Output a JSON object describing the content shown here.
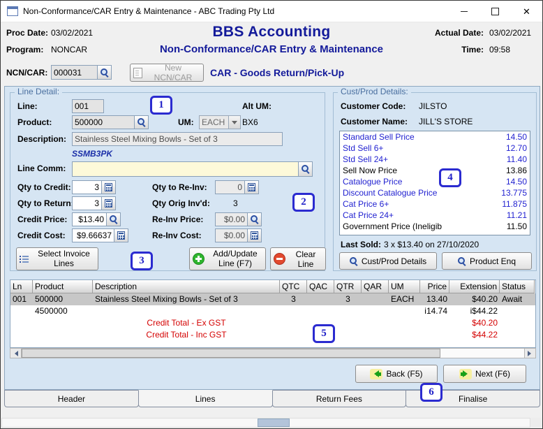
{
  "window": {
    "title": "Non-Conformance/CAR Entry & Maintenance - ABC Trading Pty Ltd"
  },
  "header": {
    "proc_date_label": "Proc Date:",
    "proc_date": "03/02/2021",
    "program_label": "Program:",
    "program": "NONCAR",
    "app_title": "BBS Accounting",
    "screen_title": "Non-Conformance/CAR Entry & Maintenance",
    "actual_date_label": "Actual Date:",
    "actual_date": "03/02/2021",
    "time_label": "Time:",
    "time": "09:58"
  },
  "ncn_bar": {
    "label": "NCN/CAR:",
    "value": "000031",
    "new_button": "New NCN/CAR",
    "car_type": "CAR - Goods Return/Pick-Up"
  },
  "line_detail": {
    "title": "Line Detail:",
    "line_label": "Line:",
    "line_value": "001",
    "product_label": "Product:",
    "product_value": "500000",
    "um_label": "UM:",
    "um_value": "EACH",
    "alt_um_label": "Alt UM:",
    "alt_um_value": "BX6",
    "description_label": "Description:",
    "description_value": "Stainless Steel Mixing Bowls - Set of 3",
    "product_code": "SSMB3PK",
    "line_comm_label": "Line Comm:",
    "line_comm_value": "",
    "qty_credit_label": "Qty to Credit:",
    "qty_credit": "3",
    "qty_reinv_label": "Qty to Re-Inv:",
    "qty_reinv": "0",
    "qty_return_label": "Qty to Return:",
    "qty_return": "3",
    "qty_orig_label": "Qty Orig Inv'd:",
    "qty_orig": "3",
    "credit_price_label": "Credit Price:",
    "credit_price": "$13.40",
    "reinv_price_label": "Re-Inv Price:",
    "reinv_price": "$0.00",
    "credit_cost_label": "Credit Cost:",
    "credit_cost": "$9.66637",
    "reinv_cost_label": "Re-Inv Cost:",
    "reinv_cost": "$0.00",
    "buttons": {
      "select_invoice": "Select Invoice Lines",
      "add_update": "Add/Update Line (F7)",
      "clear": "Clear Line"
    }
  },
  "cust_prod": {
    "title": "Cust/Prod Details:",
    "customer_code_label": "Customer Code:",
    "customer_code": "JILSTO",
    "customer_name_label": "Customer Name:",
    "customer_name": "JILL'S STORE",
    "prices": [
      {
        "label": "Standard Sell Price",
        "value": "14.50"
      },
      {
        "label": "Std Sell 6+",
        "value": "12.70"
      },
      {
        "label": "Std Sell 24+",
        "value": "11.40"
      },
      {
        "label": "Sell Now Price",
        "value": "13.86"
      },
      {
        "label": "Catalogue Price",
        "value": "14.50"
      },
      {
        "label": "Discount Catalogue Price",
        "value": "13.775"
      },
      {
        "label": "Cat Price 6+",
        "value": "11.875"
      },
      {
        "label": "Cat Price 24+",
        "value": "11.21"
      },
      {
        "label": "Government Price (Ineligib",
        "value": "11.50"
      }
    ],
    "last_sold_label": "Last Sold:",
    "last_sold": "3 x $13.40 on 27/10/2020",
    "buttons": {
      "cust_prod": "Cust/Prod Details",
      "product_enq": "Product Enq"
    }
  },
  "lines_table": {
    "columns": [
      "Ln",
      "Product",
      "Description",
      "QTC",
      "QAC",
      "QTR",
      "QAR",
      "UM",
      "Price",
      "Extension",
      "Status"
    ],
    "row": {
      "ln": "001",
      "product": "500000",
      "product2": "4500000",
      "description": "Stainless Steel Mixing Bowls - Set of 3",
      "qtc": "3",
      "qac": "",
      "qtr": "3",
      "qar": "",
      "um": "EACH",
      "price": "13.40",
      "price2": "i14.74",
      "extension": "$40.20",
      "extension2": "i$44.22",
      "status": "Await"
    },
    "totals": [
      {
        "label": "Credit Total - Ex GST",
        "value": "$40.20"
      },
      {
        "label": "Credit Total - Inc GST",
        "value": "$44.22"
      }
    ]
  },
  "nav": {
    "back": "Back (F5)",
    "next": "Next (F6)"
  },
  "tabs": {
    "header": "Header",
    "lines": "Lines",
    "return_fees": "Return Fees",
    "finalise": "Finalise"
  },
  "annotations": {
    "a1": "1",
    "a2": "2",
    "a3": "3",
    "a4": "4",
    "a5": "5",
    "a6": "6"
  },
  "colors": {
    "accent_navy": "#131a9a",
    "annotation_blue": "#2b2bd0",
    "price_blue": "#1f1fd0",
    "total_red": "#d40000",
    "page_background": "#d6e5f3",
    "comment_field_yellow": "#fdf9d9"
  }
}
